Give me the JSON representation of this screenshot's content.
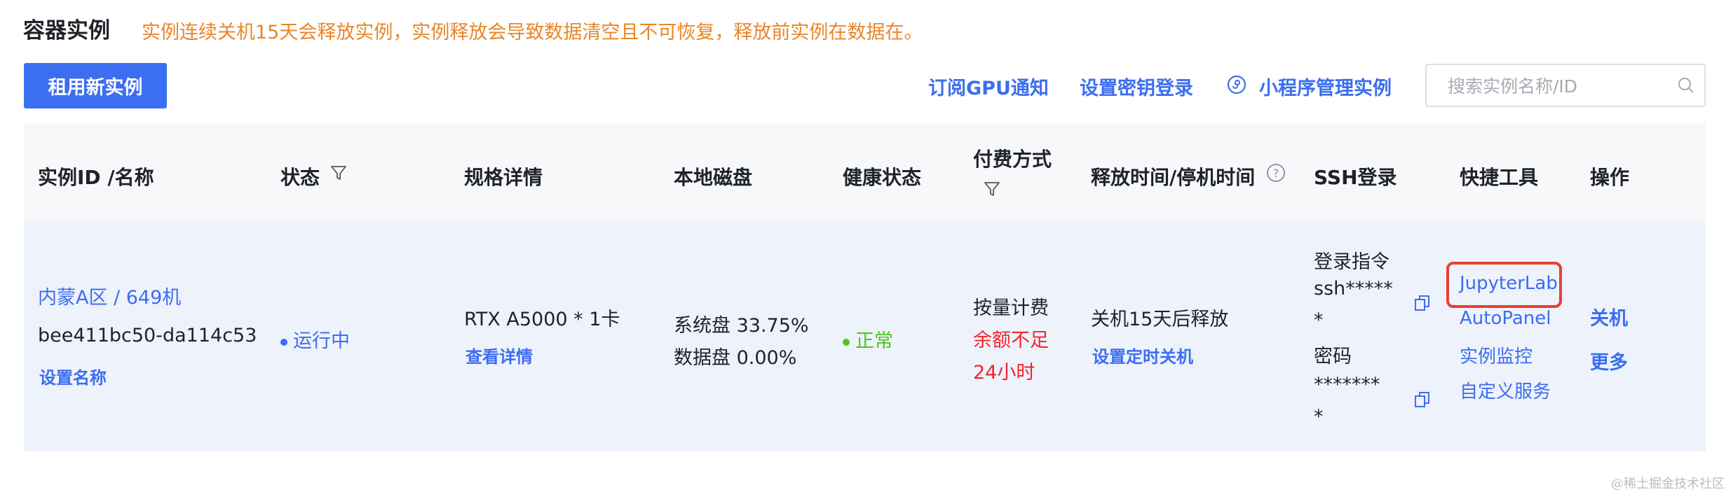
{
  "header": {
    "title": "容器实例",
    "notice": "实例连续关机15天会释放实例，实例释放会导致数据清空且不可恢复，释放前实例在数据在。"
  },
  "toolbar": {
    "rent_button": "租用新实例",
    "subscribe_gpu": "订阅GPU通知",
    "set_key_login": "设置密钥登录",
    "mini_program": "小程序管理实例",
    "search_placeholder": "搜索实例名称/ID"
  },
  "table": {
    "columns": {
      "instance": "实例ID /名称",
      "status": "状态",
      "spec": "规格详情",
      "disk": "本地磁盘",
      "health": "健康状态",
      "billing": "付费方式",
      "release": "释放时间/停机时间",
      "ssh": "SSH登录",
      "tools": "快捷工具",
      "ops": "操作"
    },
    "row": {
      "region": "内蒙A区 / 649机",
      "id": "bee411bc50-da114c53",
      "set_name": "设置名称",
      "status": "运行中",
      "spec": "RTX A5000 * 1卡",
      "spec_detail": "查看详情",
      "disk_system": "系统盘 33.75%",
      "disk_data": "数据盘 0.00%",
      "health": "正常",
      "billing": "按量计费",
      "billing_warning_1": "余额不足",
      "billing_warning_2": "24小时",
      "release": "关机15天后释放",
      "release_action": "设置定时关机",
      "ssh_cmd_label": "登录指令",
      "ssh_cmd_1": "ssh*****",
      "ssh_cmd_2": "*",
      "ssh_pwd_label": "密码",
      "ssh_pwd_1": "*******",
      "ssh_pwd_2": "*",
      "tools": [
        "JupyterLab",
        "AutoPanel",
        "实例监控",
        "自定义服务"
      ],
      "op_shutdown": "关机",
      "op_more": "更多"
    }
  },
  "watermark": "@稀土掘金技术社区",
  "colors": {
    "accent": "#3b6ef0",
    "notice": "#e8862a",
    "healthy": "#52c41a",
    "warning": "#f5222d",
    "highlight": "#e8402f"
  }
}
